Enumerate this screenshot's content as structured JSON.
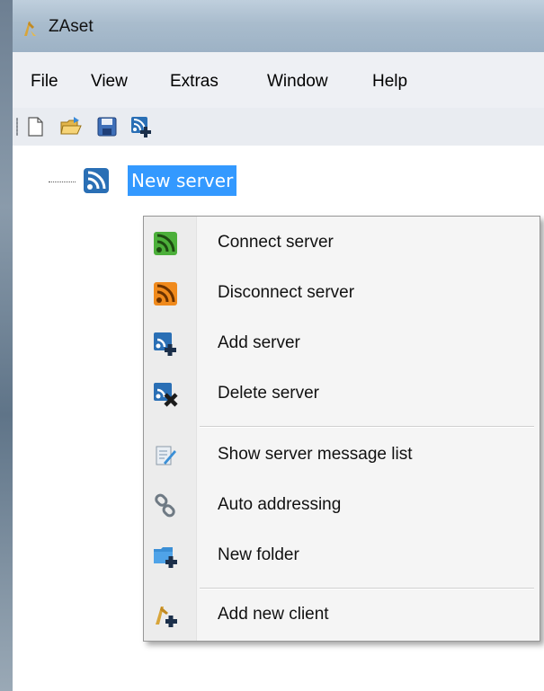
{
  "window": {
    "title": "ZAset"
  },
  "menubar": {
    "items": [
      "File",
      "View",
      "Extras",
      "Window",
      "Help"
    ]
  },
  "toolbar": {
    "buttons": [
      "new-file-icon",
      "open-folder-icon",
      "save-icon",
      "add-server-icon"
    ]
  },
  "tree": {
    "nodes": [
      {
        "label": "New server",
        "icon": "server-rss-icon",
        "selected": true
      }
    ]
  },
  "context_menu": {
    "groups": [
      [
        {
          "label": "Connect server",
          "icon": "connect-server-icon"
        },
        {
          "label": "Disconnect server",
          "icon": "disconnect-server-icon"
        },
        {
          "label": "Add server",
          "icon": "add-server-icon"
        },
        {
          "label": "Delete server",
          "icon": "delete-server-icon"
        }
      ],
      [
        {
          "label": "Show server message list",
          "icon": "message-list-icon"
        },
        {
          "label": "Auto addressing",
          "icon": "chain-link-icon"
        },
        {
          "label": "New folder",
          "icon": "new-folder-icon"
        }
      ],
      [
        {
          "label": "Add new client",
          "icon": "add-client-icon"
        }
      ]
    ]
  },
  "colors": {
    "selection": "#3399ff",
    "connect_green": "#4caf3a",
    "disconnect_orange": "#f08a1c",
    "server_blue": "#2a6fb5"
  }
}
